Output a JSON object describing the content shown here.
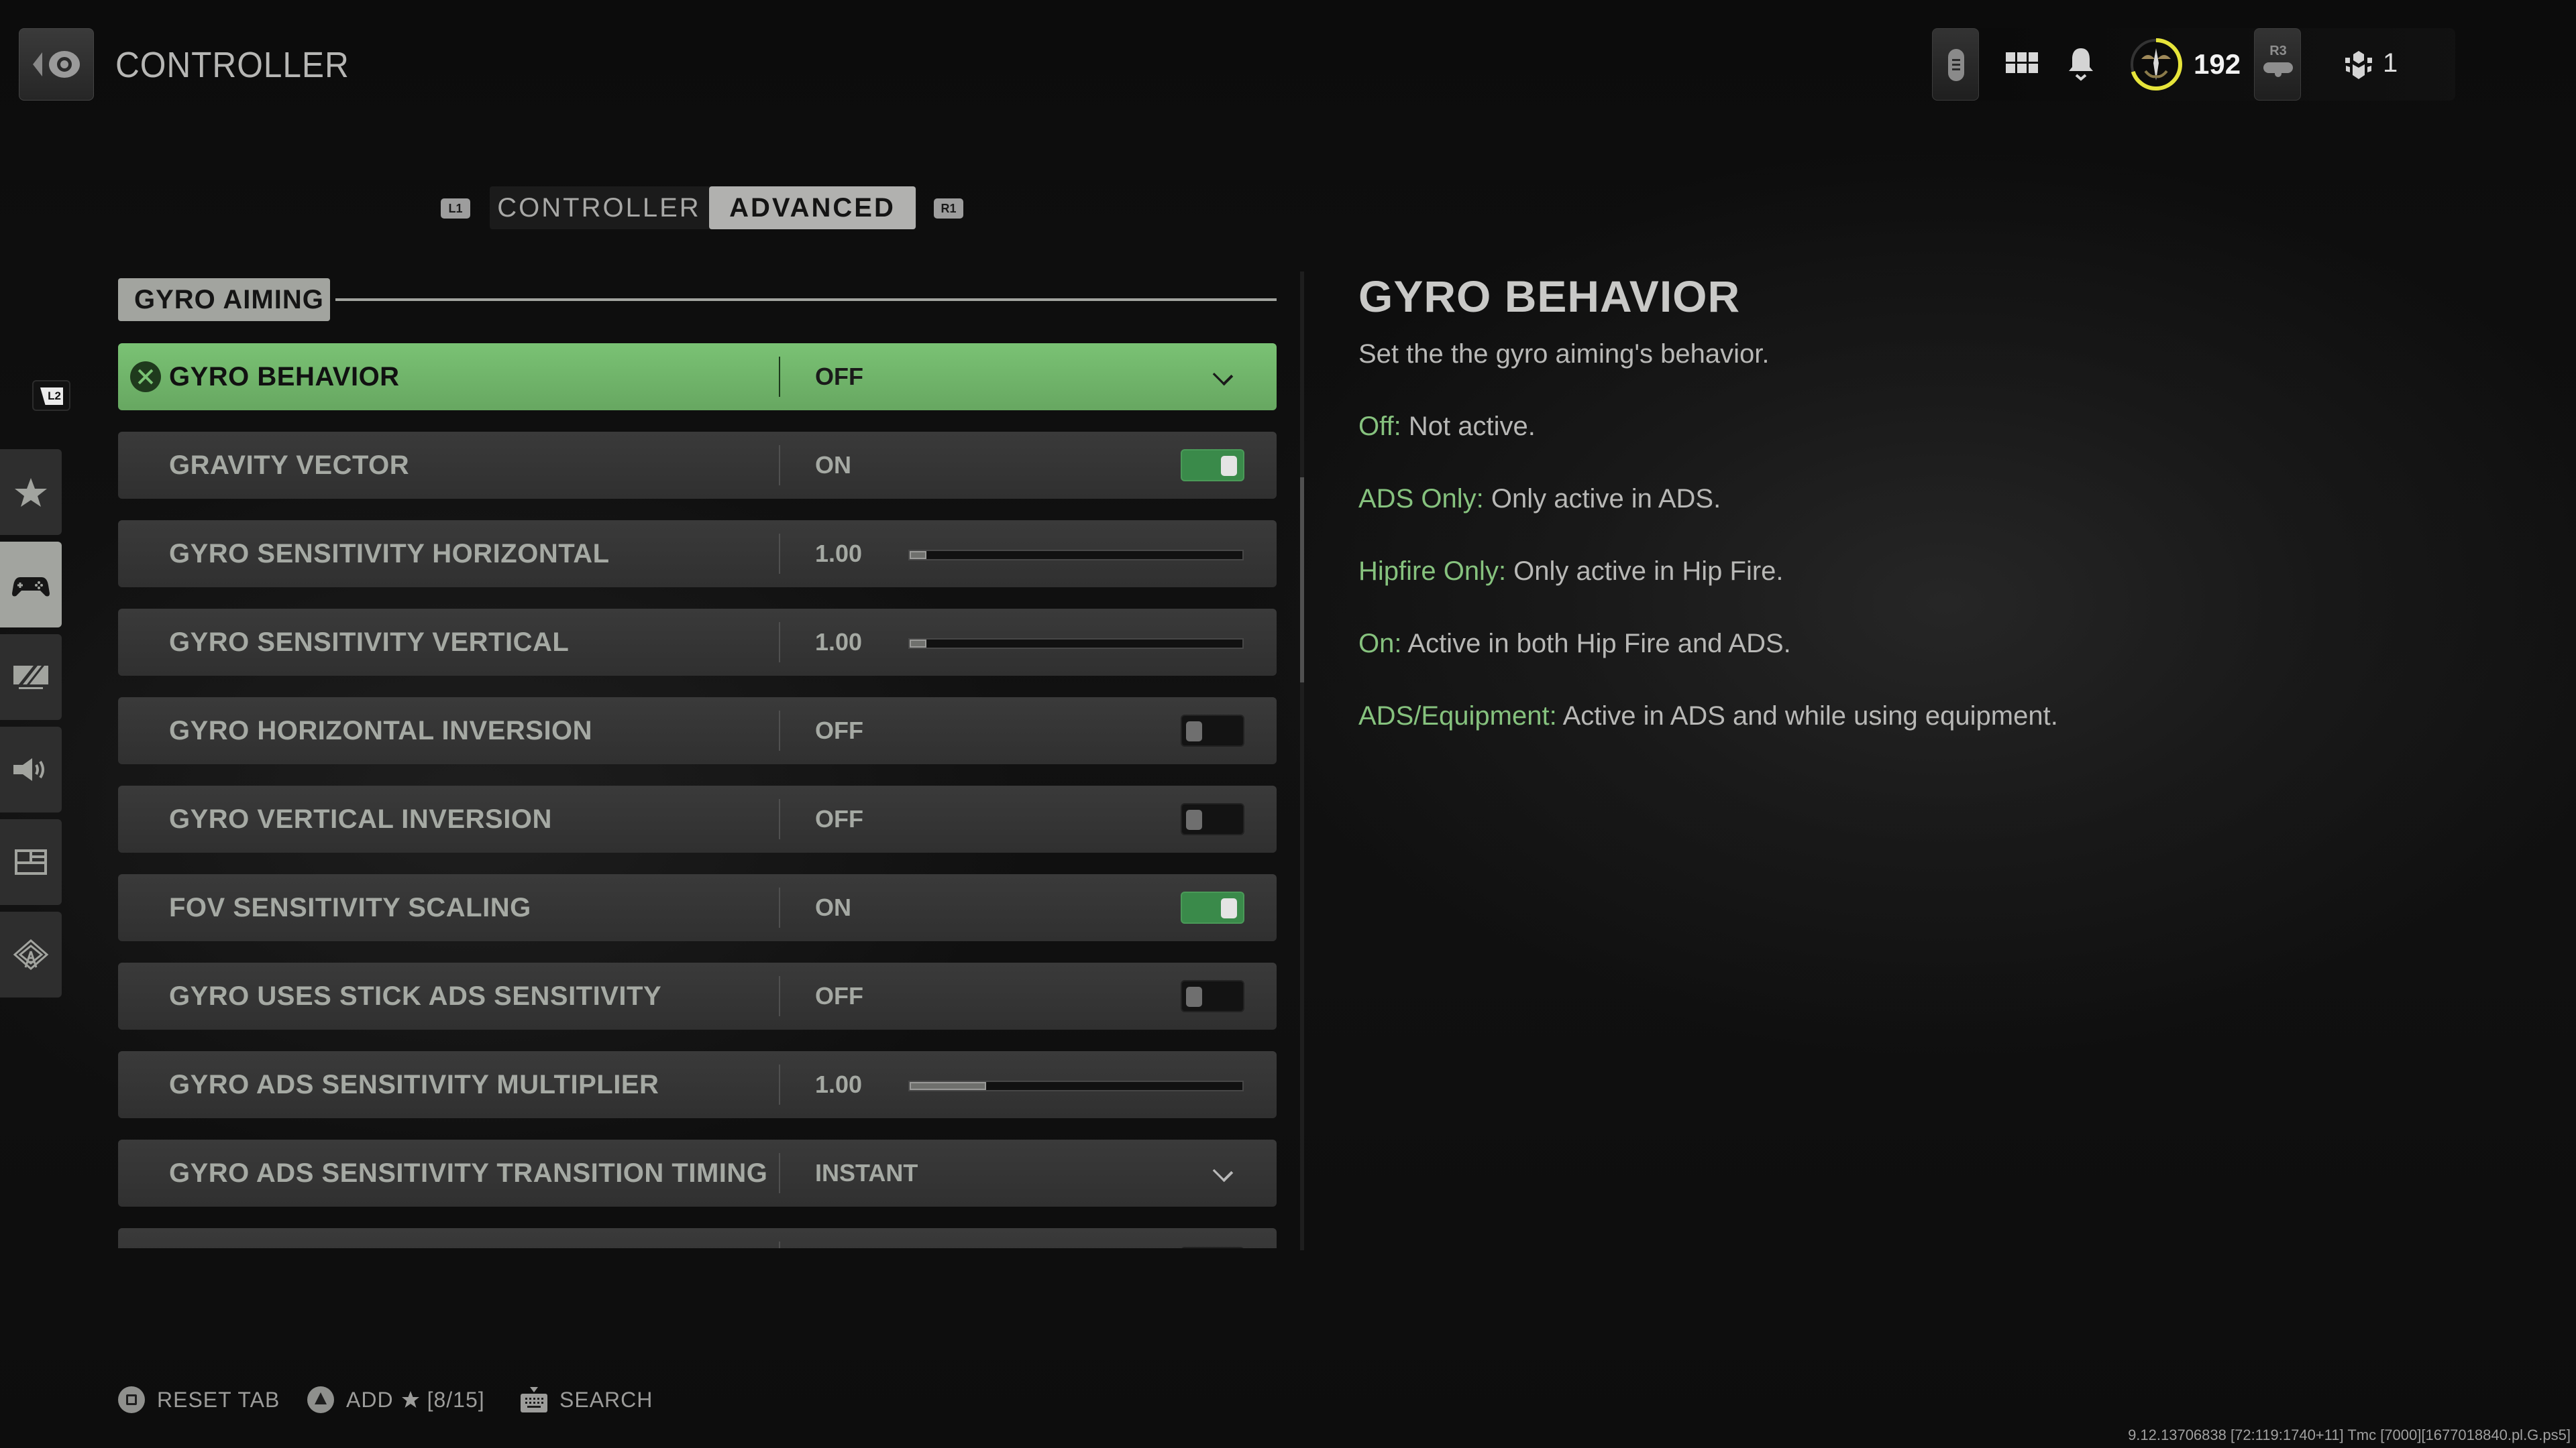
{
  "header": {
    "title": "CONTROLLER",
    "back_icon": "back-circle-button-icon",
    "rank_level": "192",
    "rank_progress_fraction": 0.7,
    "r3_label": "R3",
    "party_count": "1"
  },
  "tabs": {
    "left_bumper": "L1",
    "right_bumper": "R1",
    "items": [
      {
        "label": "CONTROLLER",
        "active": false
      },
      {
        "label": "ADVANCED",
        "active": true
      }
    ]
  },
  "sidebar": {
    "trigger_label": "L2",
    "items": [
      {
        "icon": "star-icon",
        "label": "Favorites",
        "active": false
      },
      {
        "icon": "gamepad-icon",
        "label": "Controller",
        "active": true
      },
      {
        "icon": "display-icon",
        "label": "Graphics",
        "active": false
      },
      {
        "icon": "speaker-icon",
        "label": "Audio",
        "active": false
      },
      {
        "icon": "interface-icon",
        "label": "Interface",
        "active": false
      },
      {
        "icon": "network-icon",
        "label": "Account & Network",
        "active": false
      }
    ]
  },
  "section": {
    "title": "GYRO AIMING"
  },
  "settings": [
    {
      "label": "GYRO BEHAVIOR",
      "type": "dropdown",
      "value": "OFF",
      "selected": true
    },
    {
      "label": "GRAVITY VECTOR",
      "type": "toggle",
      "value": "ON",
      "on": true
    },
    {
      "label": "GYRO SENSITIVITY HORIZONTAL",
      "type": "slider",
      "value": "1.00",
      "fill_fraction": 0.05
    },
    {
      "label": "GYRO SENSITIVITY VERTICAL",
      "type": "slider",
      "value": "1.00",
      "fill_fraction": 0.05
    },
    {
      "label": "GYRO HORIZONTAL INVERSION",
      "type": "toggle",
      "value": "OFF",
      "on": false
    },
    {
      "label": "GYRO VERTICAL INVERSION",
      "type": "toggle",
      "value": "OFF",
      "on": false
    },
    {
      "label": "FOV SENSITIVITY SCALING",
      "type": "toggle",
      "value": "ON",
      "on": true
    },
    {
      "label": "GYRO USES STICK ADS SENSITIVITY",
      "type": "toggle",
      "value": "OFF",
      "on": false
    },
    {
      "label": "GYRO ADS SENSITIVITY MULTIPLIER",
      "type": "slider",
      "value": "1.00",
      "fill_fraction": 0.23
    },
    {
      "label": "GYRO ADS SENSITIVITY TRANSITION TIMING",
      "type": "dropdown",
      "value": "INSTANT",
      "selected": false
    },
    {
      "label": "",
      "type": "toggle",
      "value": "",
      "on": false,
      "partial": true
    }
  ],
  "scrollbar": {
    "position_fraction": 0.21,
    "visible_fraction": 0.21
  },
  "description": {
    "title": "GYRO BEHAVIOR",
    "intro": "Set the the gyro aiming's behavior.",
    "options": [
      {
        "key": "Off:",
        "text": " Not active."
      },
      {
        "key": "ADS Only:",
        "text": " Only active in ADS."
      },
      {
        "key": "Hipfire Only:",
        "text": " Only active in Hip Fire."
      },
      {
        "key": "On:",
        "text": " Active in both Hip Fire and ADS."
      },
      {
        "key": "ADS/Equipment:",
        "text": " Active in ADS and while using equipment."
      }
    ]
  },
  "footer": {
    "reset_label": "RESET TAB",
    "add_label": "ADD",
    "add_count": "[8/15]",
    "search_label": "SEARCH"
  },
  "build_string": "9.12.13706838 [72:119:1740+11] Tmc [7000][1677018840.pl.G.ps5]",
  "colors": {
    "accent_green": "#7ac274",
    "toggle_on": "#3a8a4a",
    "rank_ring": "#e6e43a",
    "desc_key": "#86c27e"
  }
}
